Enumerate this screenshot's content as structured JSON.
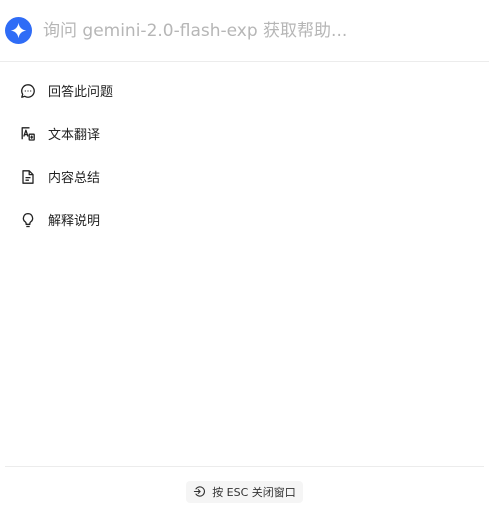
{
  "search": {
    "placeholder": "询问 gemini-2.0-flash-exp 获取帮助..."
  },
  "logo": {
    "icon": "gemini-sparkle-icon",
    "color": "#2f6cf6"
  },
  "menu": {
    "items": [
      {
        "label": "回答此问题",
        "icon": "chat-bubble-icon"
      },
      {
        "label": "文本翻译",
        "icon": "translate-icon"
      },
      {
        "label": "内容总结",
        "icon": "document-icon"
      },
      {
        "label": "解释说明",
        "icon": "lightbulb-icon"
      }
    ]
  },
  "footer": {
    "esc_hint": "按 ESC 关闭窗口",
    "icon": "exit-icon"
  }
}
